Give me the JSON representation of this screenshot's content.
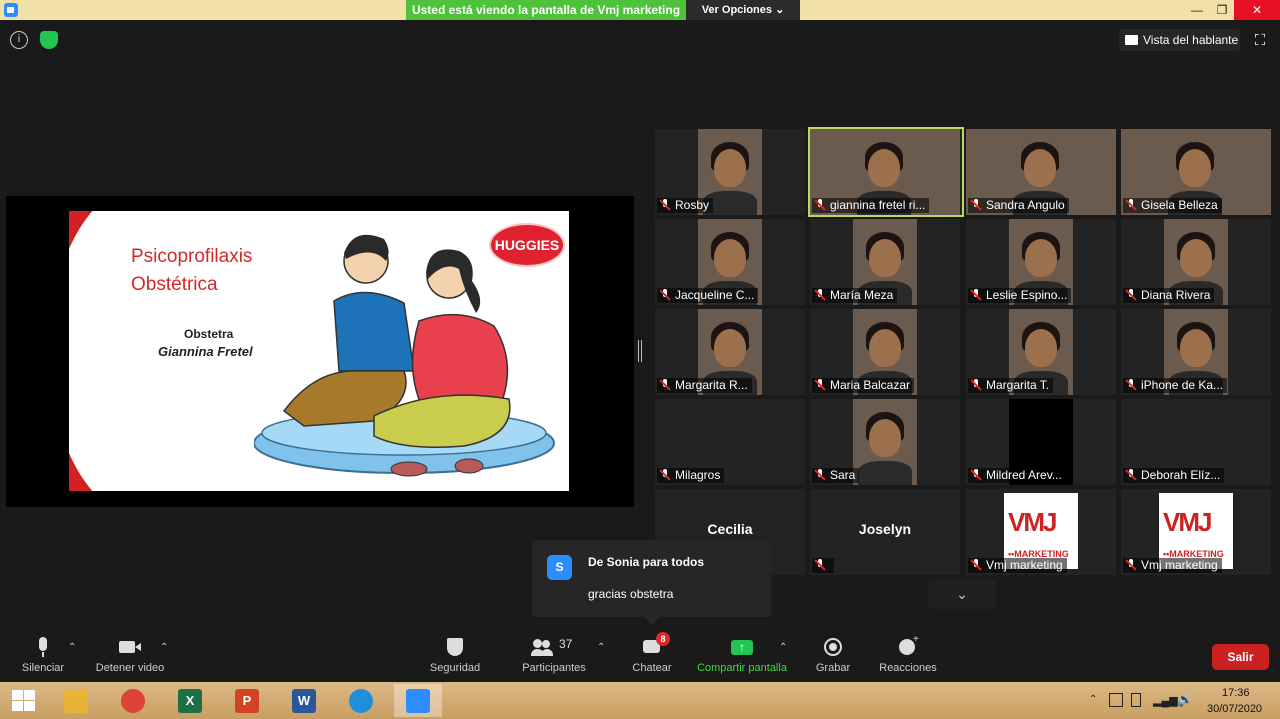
{
  "titlebar": {
    "share_banner": "Usted está viendo la pantalla de Vmj marketing",
    "view_options": "Ver Opciones ⌄",
    "minimize": "—",
    "maximize": "❐",
    "close": "✕"
  },
  "topbar": {
    "speaker_view": "Vista del hablante",
    "fullscreen": "⛶",
    "info_icon": "i"
  },
  "slide": {
    "title_line1": "Psicoprofilaxis",
    "title_line2": "Obstétrica",
    "role": "Obstetra",
    "presenter": "Giannina Fretel",
    "logo": "HUGGIES"
  },
  "participants": [
    {
      "name": "Rosby",
      "video": true,
      "wide": false
    },
    {
      "name": "giannina fretel ri...",
      "video": true,
      "wide": true,
      "active": true
    },
    {
      "name": "Sandra Angulo",
      "video": true,
      "wide": true
    },
    {
      "name": "Gisela Belleza",
      "video": true,
      "wide": true
    },
    {
      "name": "Jacqueline C...",
      "video": true,
      "wide": false
    },
    {
      "name": "María Meza",
      "video": true,
      "wide": false
    },
    {
      "name": "Leslie Espino...",
      "video": true,
      "wide": false
    },
    {
      "name": "Diana Rivera",
      "video": true,
      "wide": false
    },
    {
      "name": "Margarita R...",
      "video": true,
      "wide": false
    },
    {
      "name": "Maria Balcazar",
      "video": true,
      "wide": false
    },
    {
      "name": "Margarita T.",
      "video": true,
      "wide": false
    },
    {
      "name": "iPhone de Ka...",
      "video": true,
      "wide": false
    },
    {
      "name": "Milagros",
      "video": false
    },
    {
      "name": "Sara",
      "video": true,
      "wide": false
    },
    {
      "name": "Mildred Arev...",
      "video": false,
      "black": true
    },
    {
      "name": "Deborah Elíz...",
      "video": false
    },
    {
      "name": "",
      "bigname": "Cecilia",
      "video": false
    },
    {
      "name": "",
      "bigname": "Joselyn",
      "video": false
    },
    {
      "name": "Vmj marketing",
      "vmj": true
    },
    {
      "name": "Vmj marketing",
      "vmj": true
    }
  ],
  "vmj_logo": {
    "top": "VMJ",
    "bottom": "••MARKETING"
  },
  "chat": {
    "avatar": "S",
    "from": "De Sonia para todos",
    "message": "gracias obstetra"
  },
  "toolbar": {
    "mute": "Silenciar",
    "video": "Detener video",
    "security": "Seguridad",
    "participants": "Participantes",
    "participants_count": "37",
    "chat": "Chatear",
    "chat_badge": "8",
    "share": "Compartir pantalla",
    "record": "Grabar",
    "reactions": "Reacciones",
    "leave": "Salir"
  },
  "taskbar": {
    "time": "17:36",
    "date": "30/07/2020",
    "apps": [
      {
        "name": "file-explorer-icon",
        "glyph": "",
        "color": "#e8b436"
      },
      {
        "name": "chrome-icon",
        "glyph": "",
        "color": "#db4437"
      },
      {
        "name": "excel-icon",
        "glyph": "X",
        "color": "#1d7044"
      },
      {
        "name": "powerpoint-icon",
        "glyph": "P",
        "color": "#d04423"
      },
      {
        "name": "word-icon",
        "glyph": "W",
        "color": "#2b579a"
      },
      {
        "name": "edge-icon",
        "glyph": "",
        "color": "#1f8fdc"
      },
      {
        "name": "zoom-icon",
        "glyph": "",
        "color": "#2d8cff"
      }
    ]
  },
  "colors": {
    "share_banner": "#4ec23a",
    "accent": "#2d8cff",
    "active_speaker": "#b8d964",
    "leave": "#cc2121",
    "share_label": "#3ddb3d"
  }
}
